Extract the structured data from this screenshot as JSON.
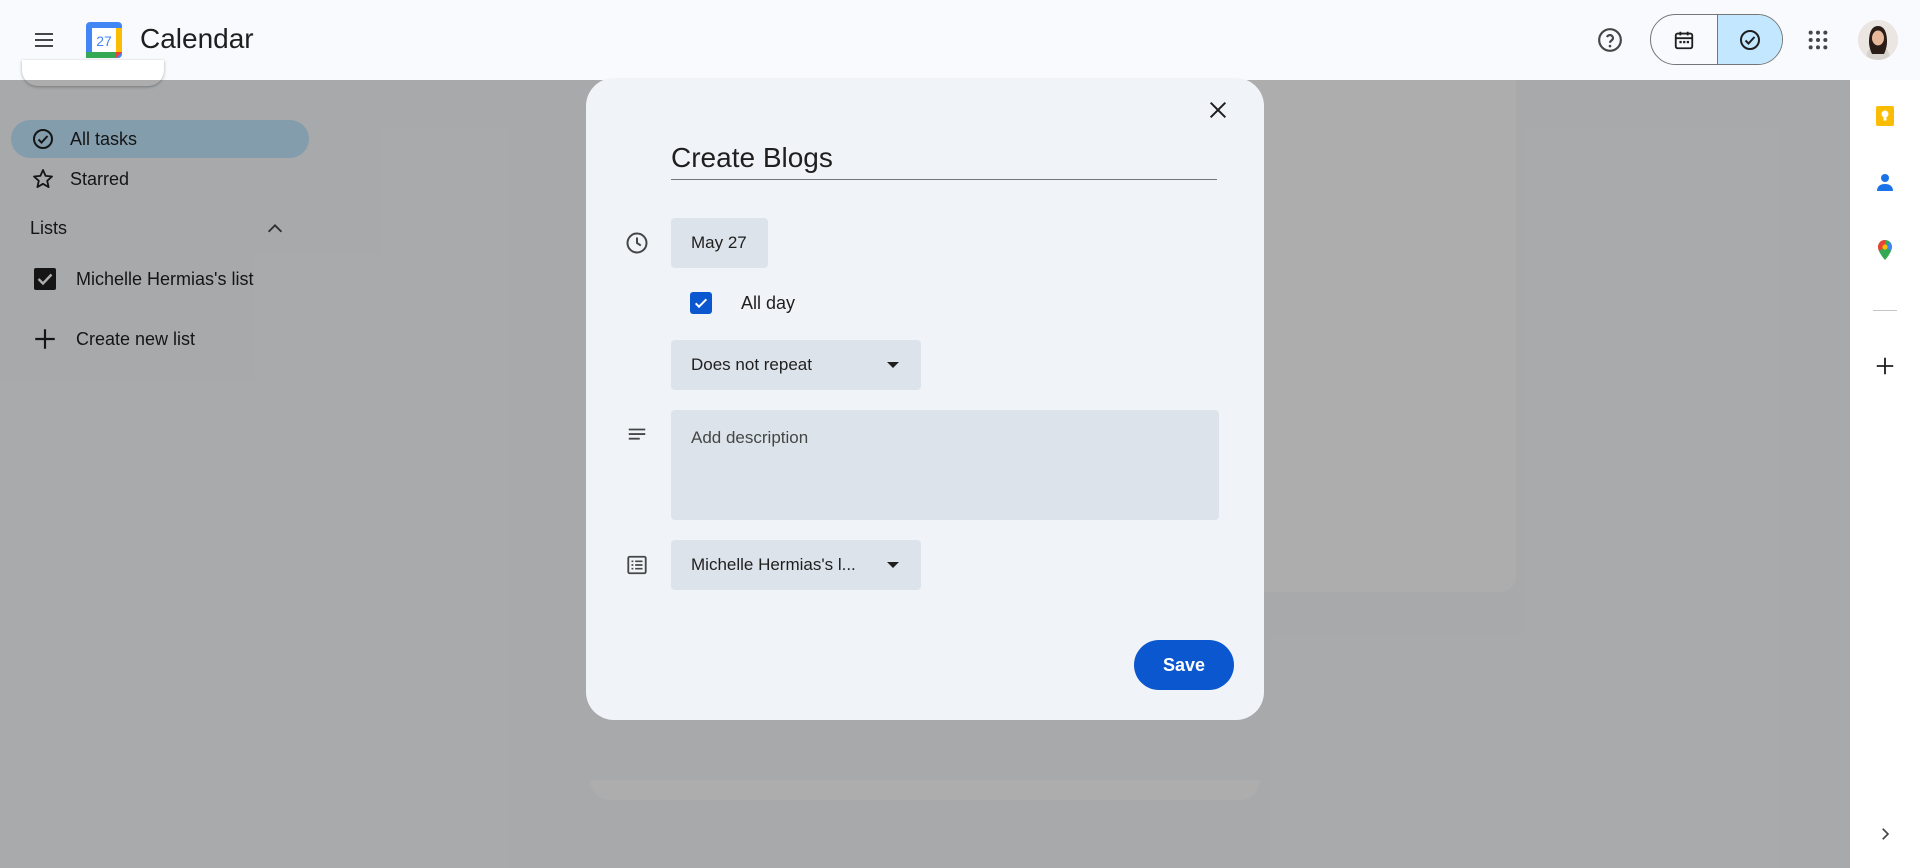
{
  "header": {
    "app_title": "Calendar",
    "logo_day": "27",
    "icons": {
      "menu": "hamburger-menu-icon",
      "help": "help-circle-icon",
      "calendar_view": "calendar-icon",
      "tasks_view": "task-check-icon",
      "apps": "apps-grid-icon",
      "avatar": "user-avatar"
    }
  },
  "sidebar": {
    "items": [
      {
        "label": "All tasks",
        "icon": "check-circle-icon",
        "selected": true
      },
      {
        "label": "Starred",
        "icon": "star-icon",
        "selected": false
      }
    ],
    "lists_header": "Lists",
    "lists": [
      {
        "label": "Michelle Hermias's list",
        "checked": true
      }
    ],
    "create_list_label": "Create new list"
  },
  "dialog": {
    "title_value": "Create Blogs",
    "date": "May 27",
    "all_day_label": "All day",
    "all_day_checked": true,
    "repeat": "Does not repeat",
    "description_placeholder": "Add description",
    "list_select": "Michelle Hermias's l...",
    "save_label": "Save"
  },
  "side_panel": {
    "icons": [
      "keep-icon",
      "contacts-icon",
      "maps-icon",
      "add-icon",
      "chevron-right-icon"
    ]
  },
  "colors": {
    "accent": "#0b57d0",
    "selected_bg": "#c2e7ff",
    "dialog_bg": "#f0f4f9",
    "field_bg": "#dde3ea",
    "scrim": "rgba(0,0,0,0.32)"
  }
}
